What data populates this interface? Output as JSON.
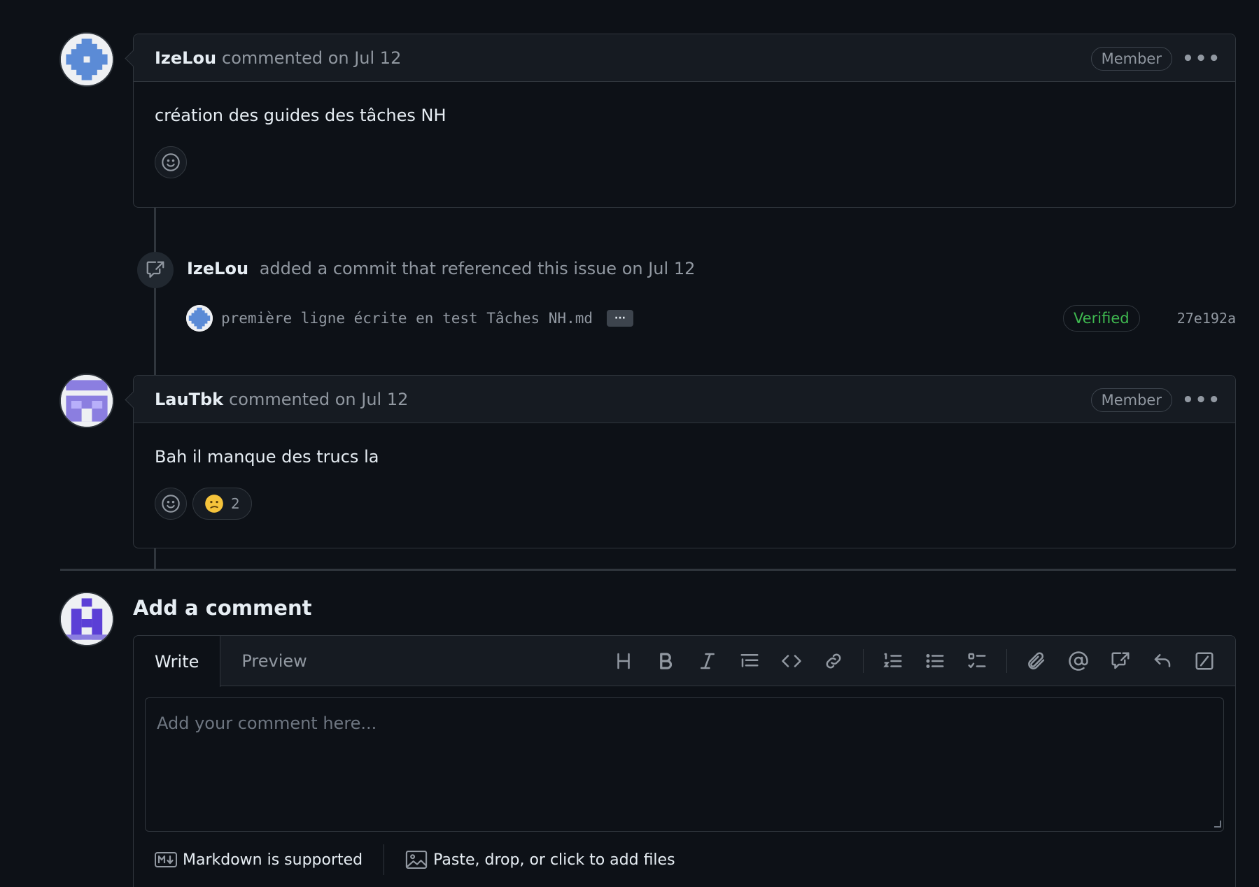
{
  "comments": [
    {
      "author": "IzeLou",
      "meta": "commented on Jul 12",
      "badge": "Member",
      "body": "création des guides des tâches NH",
      "reactions": []
    },
    {
      "author": "LauTbk",
      "meta": "commented on Jul 12",
      "badge": "Member",
      "body": "Bah il manque des trucs la",
      "reactions": [
        {
          "emoji": "confused",
          "count": "2"
        }
      ]
    }
  ],
  "event": {
    "author": "IzeLou",
    "text": "added a commit that referenced this issue on Jul 12",
    "commit_message": "première ligne écrite en test Tâches NH.md",
    "ellipsis": "···",
    "verified": "Verified",
    "sha": "27e192a"
  },
  "composer": {
    "title": "Add a comment",
    "tabs": [
      "Write",
      "Preview"
    ],
    "placeholder": "Add your comment here...",
    "markdown_note": "Markdown is supported",
    "files_note": "Paste, drop, or click to add files",
    "toolbar_icons": [
      "heading-icon",
      "bold-icon",
      "italic-icon",
      "quote-icon",
      "code-icon",
      "link-icon",
      "numbered-list-icon",
      "bulleted-list-icon",
      "task-list-icon",
      "attach-icon",
      "mention-icon",
      "cross-reference-icon",
      "reply-icon",
      "slash-command-icon"
    ]
  },
  "colors": {
    "background": "#0d1117",
    "border": "#30363d",
    "muted": "#9198a1",
    "verified": "#3fb950"
  }
}
